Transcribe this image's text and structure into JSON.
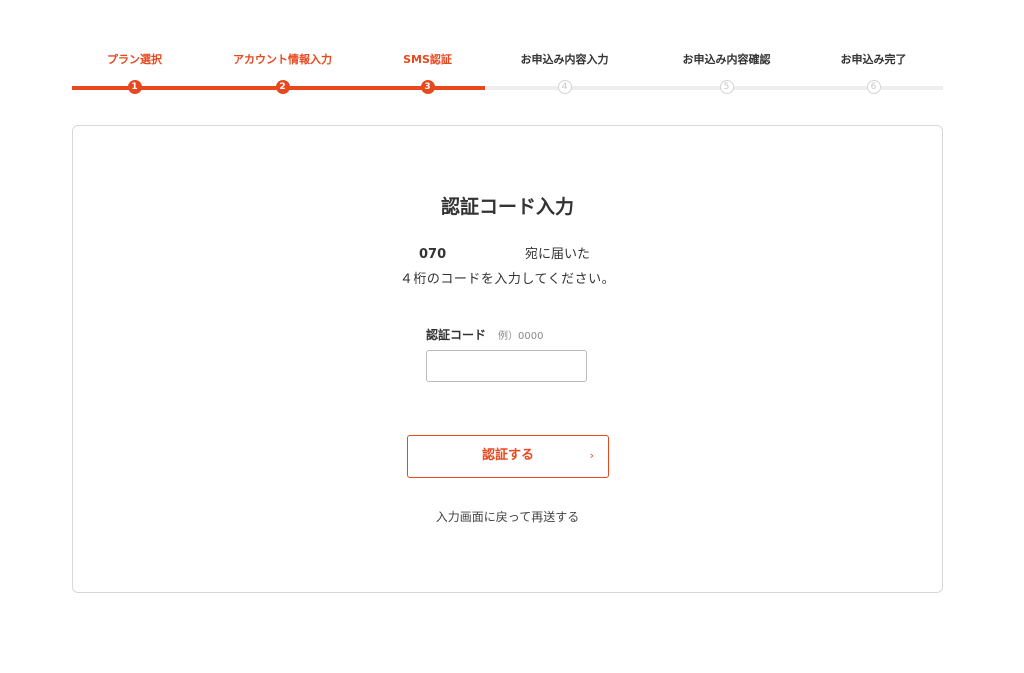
{
  "stepper": {
    "steps": [
      {
        "label": "プラン選択",
        "number": "1",
        "status": "done"
      },
      {
        "label": "アカウント情報入力",
        "number": "2",
        "status": "done"
      },
      {
        "label": "SMS認証",
        "number": "3",
        "status": "done"
      },
      {
        "label": "お申込み内容入力",
        "number": "4",
        "status": "todo"
      },
      {
        "label": "お申込み内容確認",
        "number": "5",
        "status": "todo"
      },
      {
        "label": "お申込み完了",
        "number": "6",
        "status": "todo"
      }
    ],
    "accent_color": "#e8481d",
    "inactive_color": "#eeeeee"
  },
  "card": {
    "title": "認証コード入力",
    "phone_prefix": "070",
    "sent_suffix": "宛に届いた",
    "instruction": "４桁のコードを入力してください。",
    "field_label": "認証コード",
    "field_example": "例）0000",
    "input_value": "",
    "submit_label": "認証する",
    "submit_icon": "chevron-right-icon",
    "back_link": "入力画面に戻って再送する"
  }
}
